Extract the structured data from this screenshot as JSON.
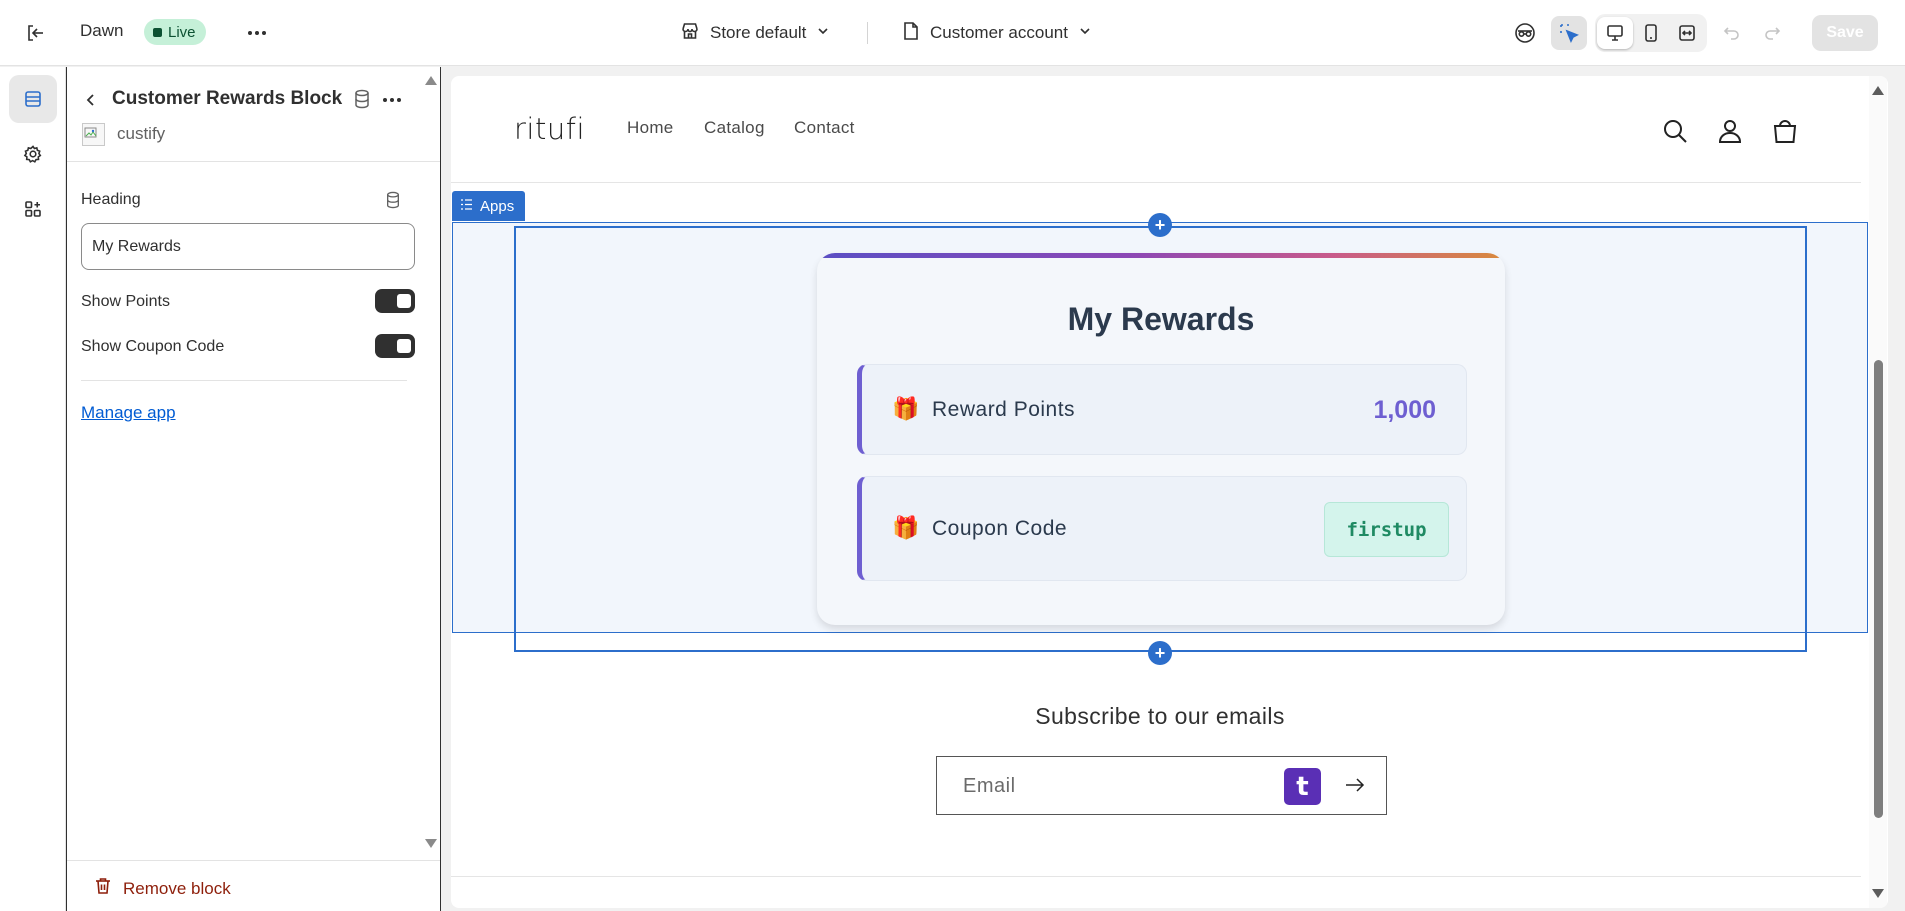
{
  "topbar": {
    "theme_name": "Dawn",
    "live_label": "Live",
    "store_select": "Store default",
    "page_select": "Customer account",
    "save_label": "Save"
  },
  "panel": {
    "block_title": "Customer Rewards Block",
    "app_name": "custify",
    "heading_label": "Heading",
    "heading_value": "My Rewards",
    "show_points_label": "Show Points",
    "show_points_on": true,
    "show_coupon_label": "Show Coupon Code",
    "show_coupon_on": true,
    "manage_app_label": "Manage app",
    "remove_block_label": "Remove block"
  },
  "store": {
    "logo": "ritufi",
    "nav": [
      "Home",
      "Catalog",
      "Contact"
    ]
  },
  "apps_tag": "Apps",
  "rewards": {
    "title": "My Rewards",
    "points_label": "Reward Points",
    "points_value": "1,000",
    "coupon_label": "Coupon Code",
    "coupon_value": "firstup",
    "icon": "🎁"
  },
  "newsletter": {
    "title": "Subscribe to our emails",
    "email_placeholder": "Email",
    "badge_letter": "t"
  },
  "colors": {
    "accent": "#2c6ecb",
    "live_bg": "#c5f0d8",
    "points": "#6e5fd1",
    "coupon_bg": "#d4f4ec",
    "danger": "#8e1f0b"
  }
}
